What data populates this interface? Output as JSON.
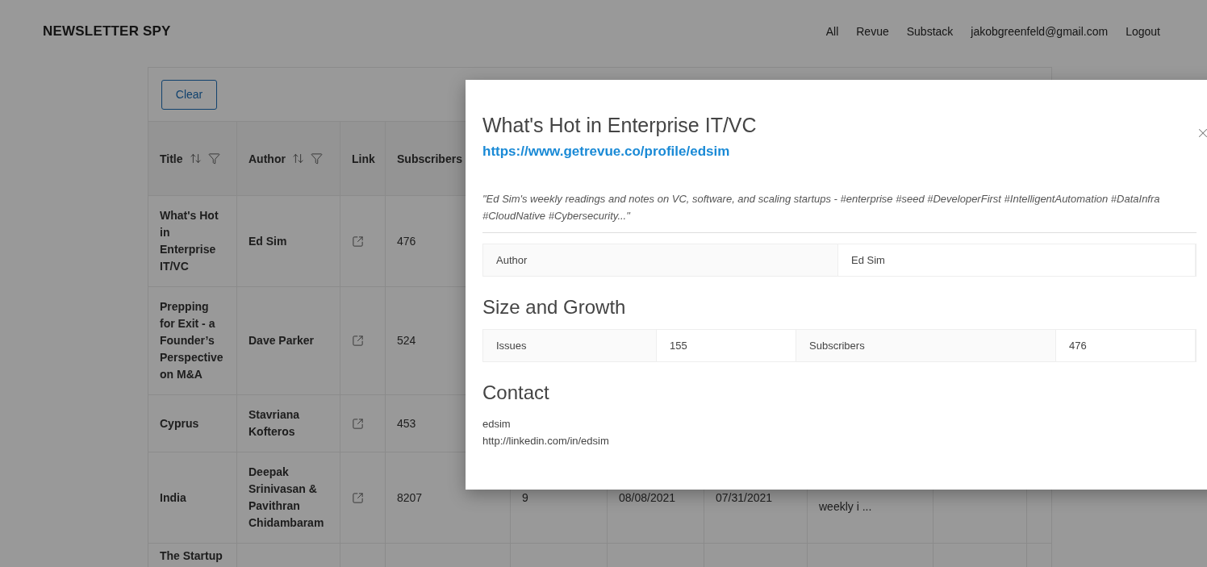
{
  "header": {
    "brand": "NEWSLETTER SPY",
    "nav": [
      "All",
      "Revue",
      "Substack",
      "jakobgreenfeld@gmail.com",
      "Logout"
    ]
  },
  "toolbar": {
    "clear_button": "Clear"
  },
  "table": {
    "columns": [
      {
        "label": "Title",
        "sortable": true,
        "filterable": true
      },
      {
        "label": "Author",
        "sortable": true,
        "filterable": true
      },
      {
        "label": "Link",
        "sortable": false,
        "filterable": false
      },
      {
        "label": "Subscribers"
      }
    ],
    "rows": [
      {
        "title": "What's Hot in Enterprise IT/VC",
        "author": "Ed Sim",
        "subscribers": "476",
        "cells": []
      },
      {
        "title": "Prepping for Exit - a Founder’s Perspective on M&A",
        "author": "Dave Parker",
        "subscribers": "524",
        "cells": []
      },
      {
        "title": "Cyprus",
        "author": "Stavriana Kofteros",
        "subscribers": "453",
        "cells": []
      },
      {
        "title": "India",
        "author": "Deepak Srinivasan & Pavithran Chidambaram",
        "subscribers": "8207",
        "cells": [
          "9",
          "08/08/2021",
          "07/31/2021",
          "weekly i ..."
        ]
      },
      {
        "title": "The Startup",
        "author": "",
        "subscribers": "",
        "cells": []
      }
    ]
  },
  "modal": {
    "title": "What's Hot in Enterprise IT/VC",
    "url": "https://www.getrevue.co/profile/edsim",
    "description": "\"Ed Sim's weekly readings and notes on VC, software, and scaling startups - #enterprise #seed #DeveloperFirst #IntelligentAutomation #DataInfra #CloudNative #Cybersecurity...\"",
    "author_row": [
      {
        "label": "Author",
        "value": "Ed Sim"
      }
    ],
    "size_heading": "Size and Growth",
    "size_row": [
      {
        "label": "Issues",
        "value": "155"
      },
      {
        "label": "Subscribers",
        "value": "476"
      }
    ],
    "contact_heading": "Contact",
    "contact_lines": [
      "edsim",
      "http://linkedin.com/in/edsim"
    ]
  }
}
